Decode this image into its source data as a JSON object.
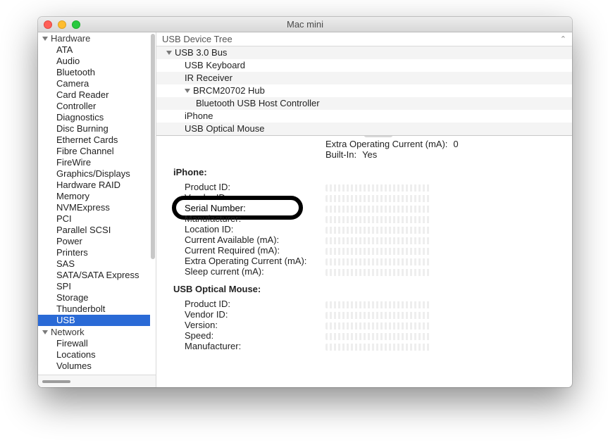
{
  "window": {
    "title": "Mac mini"
  },
  "sidebar": {
    "groups": [
      {
        "label": "Hardware",
        "items": [
          "ATA",
          "Audio",
          "Bluetooth",
          "Camera",
          "Card Reader",
          "Controller",
          "Diagnostics",
          "Disc Burning",
          "Ethernet Cards",
          "Fibre Channel",
          "FireWire",
          "Graphics/Displays",
          "Hardware RAID",
          "Memory",
          "NVMExpress",
          "PCI",
          "Parallel SCSI",
          "Power",
          "Printers",
          "SAS",
          "SATA/SATA Express",
          "SPI",
          "Storage",
          "Thunderbolt",
          "USB"
        ],
        "selected": "USB"
      },
      {
        "label": "Network",
        "items": [
          "Firewall",
          "Locations",
          "Volumes"
        ]
      }
    ]
  },
  "tree": {
    "header": "USB Device Tree",
    "rows": [
      {
        "indent": 1,
        "label": "USB 3.0 Bus",
        "expandable": true
      },
      {
        "indent": 2,
        "label": "USB Keyboard"
      },
      {
        "indent": 2,
        "label": "IR Receiver"
      },
      {
        "indent": 2,
        "label": "BRCM20702 Hub",
        "expandable": true
      },
      {
        "indent": 3,
        "label": "Bluetooth USB Host Controller"
      },
      {
        "indent": 2,
        "label": "iPhone"
      },
      {
        "indent": 2,
        "label": "USB Optical Mouse"
      }
    ]
  },
  "detail": {
    "top_kv": [
      {
        "k": "Extra Operating Current (mA):",
        "v": "0"
      },
      {
        "k": "Built-In:",
        "v": "Yes"
      }
    ],
    "sections": [
      {
        "title": "iPhone:",
        "rows": [
          {
            "k": "Product ID:"
          },
          {
            "k": "Vendor ID:"
          },
          {
            "k": "Serial Number:",
            "highlight": true
          },
          {
            "k": "Manufacturer:"
          },
          {
            "k": "Location ID:"
          },
          {
            "k": "Current Available (mA):"
          },
          {
            "k": "Current Required (mA):"
          },
          {
            "k": "Extra Operating Current (mA):"
          },
          {
            "k": "Sleep current (mA):"
          }
        ]
      },
      {
        "title": "USB Optical Mouse:",
        "rows": [
          {
            "k": "Product ID:"
          },
          {
            "k": "Vendor ID:"
          },
          {
            "k": "Version:"
          },
          {
            "k": "Speed:"
          },
          {
            "k": "Manufacturer:"
          }
        ]
      }
    ]
  }
}
